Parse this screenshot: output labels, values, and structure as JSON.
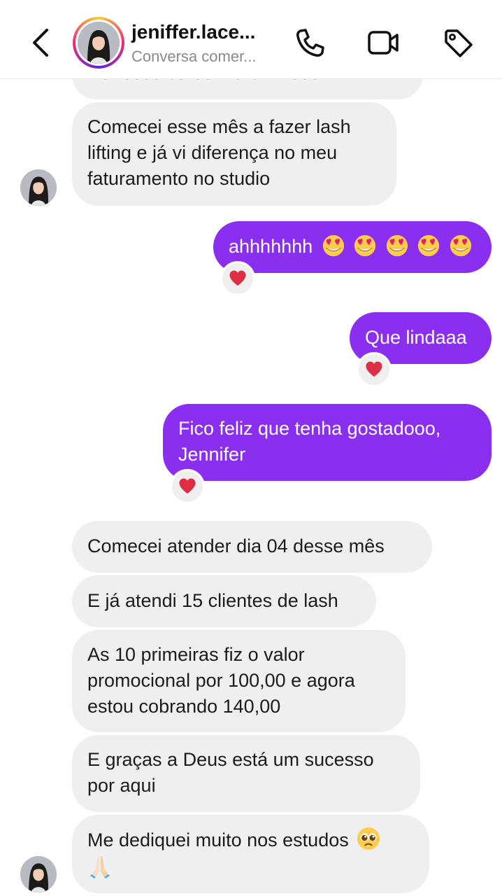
{
  "header": {
    "contact_name": "jeniffer.lace...",
    "contact_status": "Conversa comer...",
    "icons": [
      "chevron-left-icon",
      "phone-icon",
      "video-camera-icon",
      "tag-icon"
    ]
  },
  "messages": [
    {
      "from": "them",
      "text": "Por esse curso maravilhoso"
    },
    {
      "from": "them",
      "text": "Comecei esse mês a fazer lash\nlifting e já vi diferença no meu\nfaturamento no studio"
    },
    {
      "from": "me",
      "text": "ahhhhhhh",
      "emoji": "smiling-face-with-heart-eyes x5",
      "reaction": "red-heart"
    },
    {
      "from": "me",
      "text": "Que lindaaa",
      "reaction": "red-heart"
    },
    {
      "from": "me",
      "text": "Fico feliz que tenha gostadooo,\nJennifer",
      "reaction": "red-heart"
    },
    {
      "from": "them",
      "text": "Comecei atender dia 04 desse mês"
    },
    {
      "from": "them",
      "text": "E já atendi 15 clientes de lash"
    },
    {
      "from": "them",
      "text": "As 10 primeiras fiz o valor\npromocional por 100,00 e agora\nestou cobrando 140,00"
    },
    {
      "from": "them",
      "text": "E graças a Deus está um sucesso\npor aqui"
    },
    {
      "from": "them",
      "text": "Me dediquei muito nos estudos",
      "emoji": "pleading-face, folded-hands"
    }
  ],
  "colors": {
    "outgoing_bubble": "#8a2ff0",
    "incoming_bubble": "#efefef",
    "reaction_heart": "#e0245e"
  }
}
